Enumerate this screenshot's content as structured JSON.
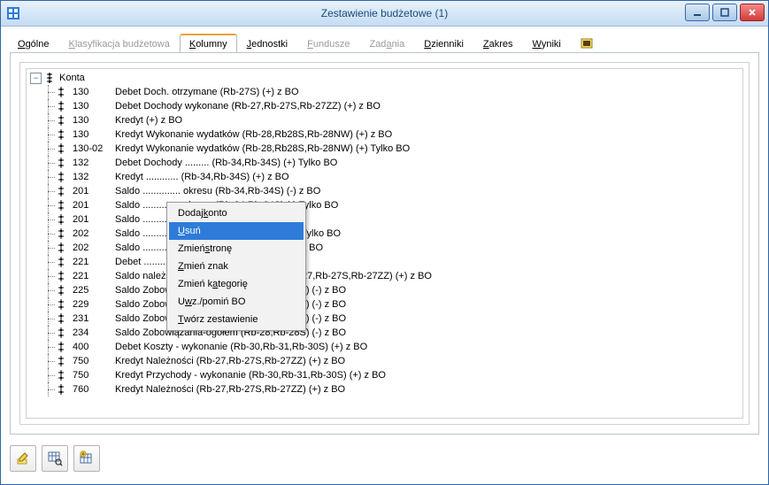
{
  "window": {
    "title": "Zestawienie budżetowe (1)"
  },
  "tabs": [
    {
      "label": "Ogólne",
      "ul": "O",
      "rest": "gólne",
      "state": "normal"
    },
    {
      "label": "Klasyfikacja budżetowa",
      "ul": "K",
      "rest": "lasyfikacja budżetowa",
      "state": "disabled"
    },
    {
      "label": "Kolumny",
      "ul": "K",
      "rest": "olumny",
      "state": "active"
    },
    {
      "label": "Jednostki",
      "ul": "J",
      "rest": "ednostki",
      "state": "normal"
    },
    {
      "label": "Fundusze",
      "ul": "F",
      "rest": "undusze",
      "state": "disabled"
    },
    {
      "label": "Zadania",
      "pre": "Zad",
      "ul": "a",
      "rest": "nia",
      "state": "disabled"
    },
    {
      "label": "Dzienniki",
      "ul": "D",
      "rest": "zienniki",
      "state": "normal"
    },
    {
      "label": "Zakres",
      "ul": "Z",
      "rest": "akres",
      "state": "normal"
    },
    {
      "label": "Wyniki",
      "ul": "W",
      "rest": "yniki",
      "state": "normal"
    }
  ],
  "tree": {
    "root_label": "Konta",
    "rows": [
      {
        "code": "130",
        "desc": "Debet Doch. otrzymane (Rb-27S) (+) z BO"
      },
      {
        "code": "130",
        "desc": "Debet Dochody wykonane (Rb-27,Rb-27S,Rb-27ZZ) (+) z BO"
      },
      {
        "code": "130",
        "desc": "Kredyt  (+) z BO"
      },
      {
        "code": "130",
        "desc": "Kredyt Wykonanie wydatków (Rb-28,Rb28S,Rb-28NW) (+) z BO"
      },
      {
        "code": "130-02",
        "desc": "Kredyt Wykonanie wydatków (Rb-28,Rb28S,Rb-28NW) (+) Tylko BO"
      },
      {
        "code": "132",
        "desc": "Debet Dochody ......... (Rb-34,Rb-34S) (+) Tylko BO"
      },
      {
        "code": "132",
        "desc": "Kredyt ............ (Rb-34,Rb-34S) (+) z BO"
      },
      {
        "code": "201",
        "desc": "Saldo .............. okresu (Rb-34,Rb-34S) (-) z BO"
      },
      {
        "code": "201",
        "desc": "Saldo .............. okresu (Rb-34,Rb-34S) (-) Tylko BO"
      },
      {
        "code": "201",
        "desc": "Saldo ............ (Rb-28,Rb-28S) (-) z BO"
      },
      {
        "code": "202",
        "desc": "Saldo .............. okresu (Rb-34,Rb-34S) (+) Tylko BO"
      },
      {
        "code": "202",
        "desc": "Saldo .............. okresu (Rb-34,Rb-34S) (+) z BO"
      },
      {
        "code": "221",
        "desc": "Debet ........... (Rb-27ZZ) (+) Tylko BO"
      },
      {
        "code": "221",
        "desc": "Saldo należności pozostałe do zapłaty (Rb-27,Rb-27S,Rb-27ZZ) (+) z BO"
      },
      {
        "code": "225",
        "desc": "Saldo Zobowiązania-ogółem (Rb-28,Rb-28S) (-) z BO"
      },
      {
        "code": "229",
        "desc": "Saldo Zobowiązania-ogółem (Rb-28,Rb-28S) (-) z BO"
      },
      {
        "code": "231",
        "desc": "Saldo Zobowiązania-ogółem (Rb-28,Rb-28S) (-) z BO"
      },
      {
        "code": "234",
        "desc": "Saldo Zobowiązania-ogółem (Rb-28,Rb-28S) (-) z BO"
      },
      {
        "code": "400",
        "desc": "Debet Koszty - wykonanie (Rb-30,Rb-31,Rb-30S) (+) z BO"
      },
      {
        "code": "750",
        "desc": "Kredyt Należności (Rb-27,Rb-27S,Rb-27ZZ) (+) z BO"
      },
      {
        "code": "750",
        "desc": "Kredyt Przychody - wykonanie (Rb-30,Rb-31,Rb-30S) (+) z BO"
      },
      {
        "code": "760",
        "desc": "Kredyt Należności (Rb-27,Rb-27S,Rb-27ZZ) (+) z BO"
      }
    ]
  },
  "context_menu": {
    "items": [
      {
        "pre": "Dodaj ",
        "ul": "k",
        "rest": "onto",
        "sel": false
      },
      {
        "pre": "",
        "ul": "U",
        "rest": "suń",
        "sel": true
      },
      {
        "pre": "Zmień ",
        "ul": "s",
        "rest": "tronę",
        "sel": false
      },
      {
        "pre": "",
        "ul": "Z",
        "rest": "mień znak",
        "sel": false
      },
      {
        "pre": "Zmień k",
        "ul": "a",
        "rest": "tegorię",
        "sel": false
      },
      {
        "pre": "U",
        "ul": "w",
        "rest": "z./pomiń BO",
        "sel": false
      },
      {
        "pre": "",
        "ul": "T",
        "rest": "wórz zestawienie",
        "sel": false
      }
    ]
  },
  "buttons": [
    "edit",
    "grid-search",
    "grid-add"
  ]
}
